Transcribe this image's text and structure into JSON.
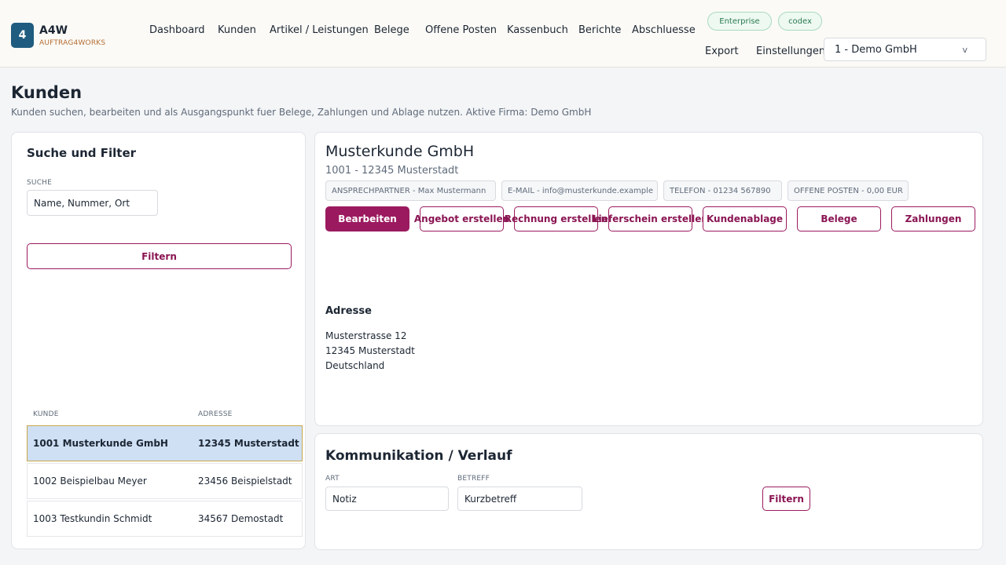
{
  "app": {
    "logo_mark": "4",
    "name": "A4W",
    "subtitle": "AUFTRAG4WORKS"
  },
  "nav": [
    "Dashboard",
    "Kunden",
    "Artikel / Leistungen",
    "Belege",
    "Offene Posten",
    "Kassenbuch",
    "Berichte",
    "Abschluesse"
  ],
  "badges": [
    "Enterprise",
    "codex"
  ],
  "top_links": {
    "export": "Export",
    "settings": "Einstellungen"
  },
  "company_select": {
    "value": "1 - Demo GmbH",
    "chevron": "v"
  },
  "page": {
    "title": "Kunden",
    "subtitle": "Kunden suchen, bearbeiten und als Ausgangspunkt fuer Belege, Zahlungen und Ablage nutzen. Aktive Firma: Demo GmbH"
  },
  "filter": {
    "title": "Suche und Filter",
    "search_label": "SUCHE",
    "search_placeholder": "Name, Nummer, Ort",
    "button": "Filtern"
  },
  "table": {
    "headers": [
      "KUNDE",
      "ADRESSE"
    ],
    "rows": [
      {
        "customer": "1001 Musterkunde GmbH",
        "address": "12345 Musterstadt",
        "selected": true
      },
      {
        "customer": "1002 Beispielbau Meyer",
        "address": "23456 Beispielstadt",
        "selected": false
      },
      {
        "customer": "1003 Testkundin Schmidt",
        "address": "34567 Demostadt",
        "selected": false
      }
    ]
  },
  "detail": {
    "name": "Musterkunde GmbH",
    "subline": "1001 - 12345 Musterstadt",
    "pills": [
      "ANSPRECHPARTNER - Max Mustermann",
      "E-MAIL - info@musterkunde.example",
      "TELEFON - 01234 567890",
      "OFFENE POSTEN - 0,00 EUR"
    ],
    "actions": [
      "Bearbeiten",
      "Angebot erstellen",
      "Rechnung erstellen",
      "Lieferschein erstellen",
      "Kundenablage",
      "Belege",
      "Zahlungen"
    ],
    "address_title": "Adresse",
    "address_lines": [
      "Musterstrasse 12",
      "12345 Musterstadt",
      "Deutschland"
    ]
  },
  "communication": {
    "title": "Kommunikation / Verlauf",
    "type_label": "ART",
    "type_value": "Notiz",
    "subject_label": "BETREFF",
    "subject_placeholder": "Kurzbetreff",
    "button": "Filtern"
  },
  "colors": {
    "accent": "#9b1a5f",
    "logo": "#1f5c80",
    "selected_row": "#cfe0f5"
  }
}
